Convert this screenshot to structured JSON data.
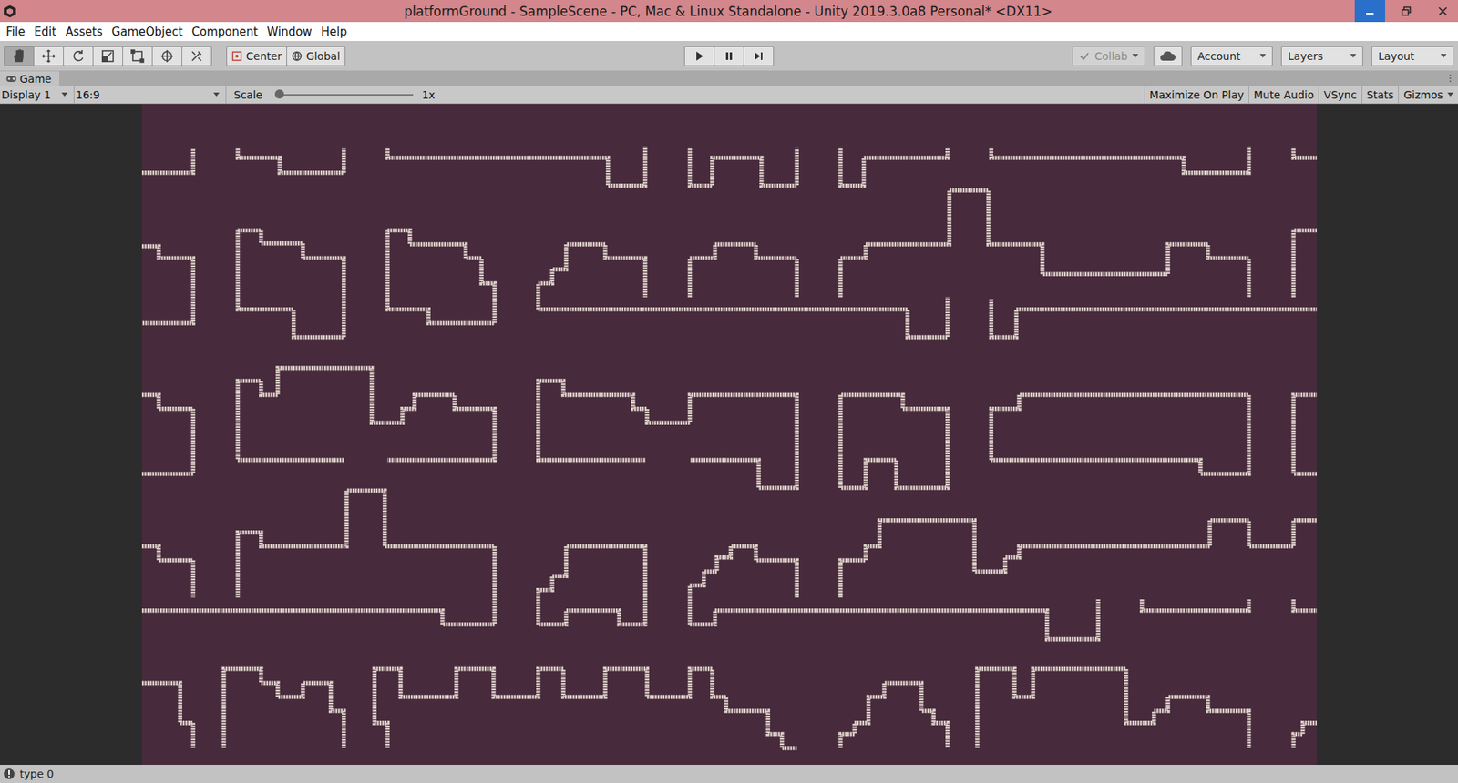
{
  "window": {
    "title": "platformGround - SampleScene - PC, Mac & Linux Standalone - Unity 2019.3.0a8 Personal* <DX11>"
  },
  "menu": [
    "File",
    "Edit",
    "Assets",
    "GameObject",
    "Component",
    "Window",
    "Help"
  ],
  "toolbar": {
    "tools": [
      {
        "kind": "hand",
        "selected": true
      },
      {
        "kind": "move",
        "selected": false
      },
      {
        "kind": "rotate",
        "selected": false
      },
      {
        "kind": "scale",
        "selected": false
      },
      {
        "kind": "rect",
        "selected": false
      },
      {
        "kind": "transform",
        "selected": false
      },
      {
        "kind": "custom",
        "selected": false
      }
    ],
    "pivot": [
      {
        "kind": "center",
        "label": "Center"
      },
      {
        "kind": "global",
        "label": "Global"
      }
    ],
    "playback": [
      {
        "kind": "play",
        "selected": false
      },
      {
        "kind": "pause",
        "selected": false
      },
      {
        "kind": "step",
        "selected": false
      }
    ],
    "collab": {
      "label": "Collab",
      "disabled": true
    },
    "dropdowns": [
      "Account",
      "Layers",
      "Layout"
    ]
  },
  "game_view": {
    "tab": "Game",
    "display": "Display 1",
    "aspect": "16:9",
    "scale_label": "Scale",
    "scale_value": "1x",
    "scale_level": 0,
    "toggles": [
      {
        "label": "Maximize On Play",
        "selected": false
      },
      {
        "label": "Mute Audio",
        "selected": false
      },
      {
        "label": "VSync",
        "selected": false
      },
      {
        "label": "Stats",
        "selected": false
      }
    ],
    "gizmos": "Gizmos"
  },
  "status_bar": {
    "message": "type 0"
  }
}
